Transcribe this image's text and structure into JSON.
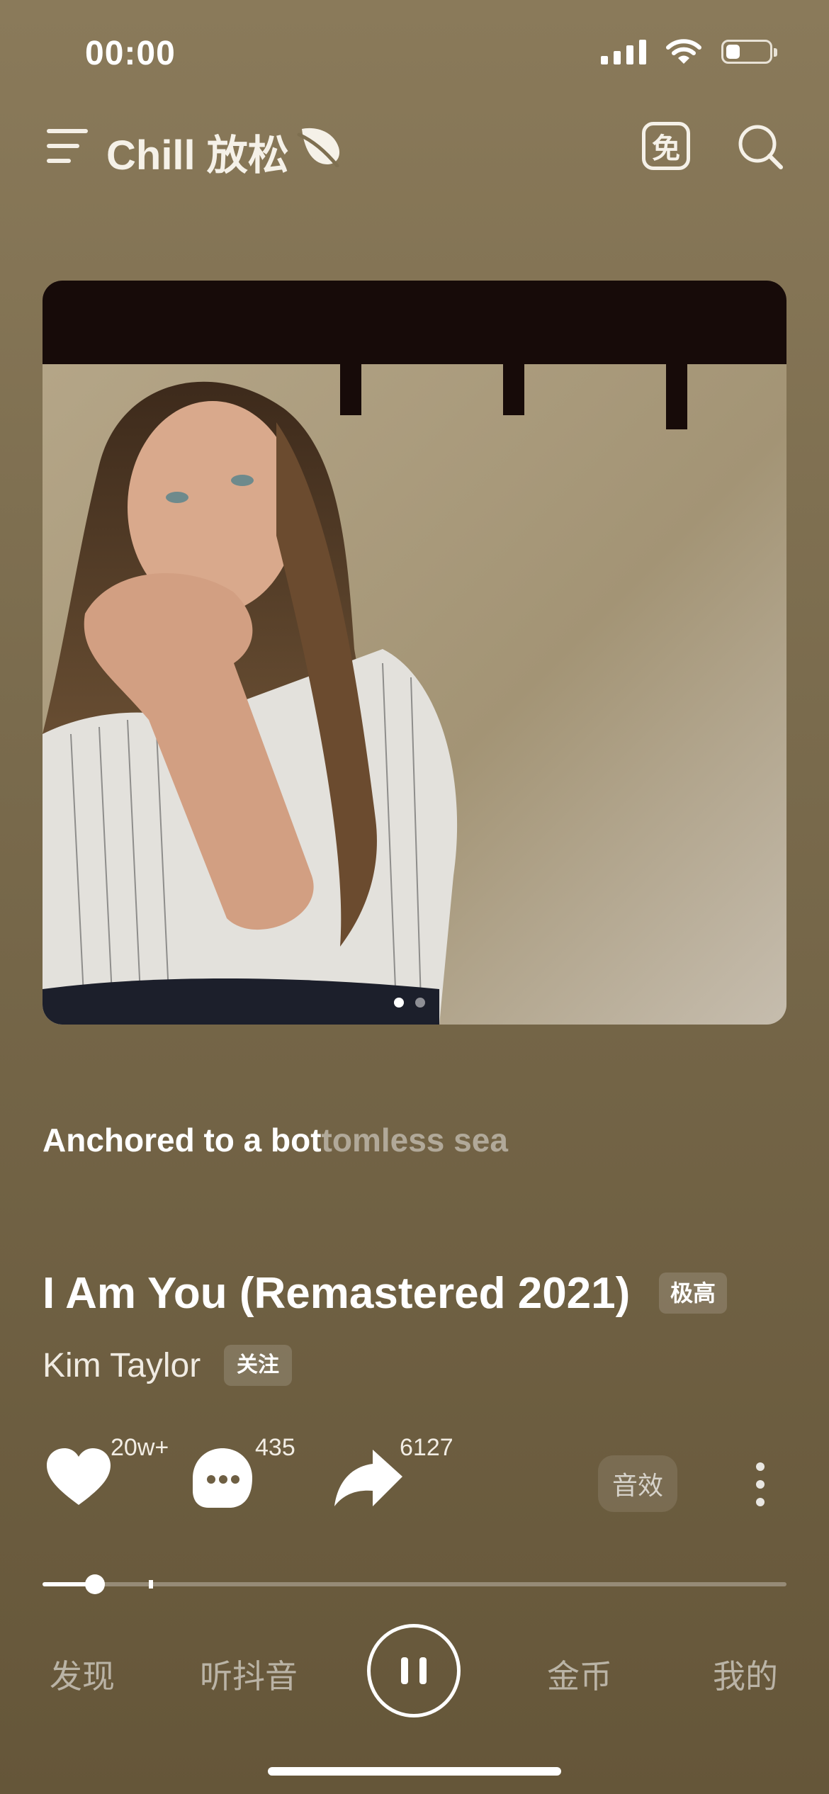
{
  "status_bar": {
    "time": "00:00",
    "battery_level": 0.33
  },
  "header": {
    "title": "Chill 放松",
    "free_icon_glyph": "免"
  },
  "album": {
    "page_indicator": {
      "total": 2,
      "current": 1
    }
  },
  "lyric": {
    "sung": "Anchored to a bot",
    "unsung": "tomless sea"
  },
  "song": {
    "title": "I Am You (Remastered 2021)",
    "quality": "极高"
  },
  "artist": {
    "name": "Kim Taylor",
    "follow_label": "关注"
  },
  "actions": {
    "like_count": "20w+",
    "comment_count": "435",
    "share_count": "6127",
    "effects_label": "音效"
  },
  "progress": {
    "played_fraction": 0.07,
    "buffered_fraction": 0.146
  },
  "nav": {
    "discover": "发现",
    "listen_douyin": "听抖音",
    "coins": "金币",
    "mine": "我的"
  },
  "icons": [
    "menu-icon",
    "leaf-icon",
    "free-icon",
    "search-icon",
    "heart-icon",
    "comment-icon",
    "share-icon",
    "more-icon",
    "pause-icon"
  ],
  "colors": {
    "background_top": "#8a7a5a",
    "background_bottom": "#655639",
    "text": "#ffffff"
  }
}
